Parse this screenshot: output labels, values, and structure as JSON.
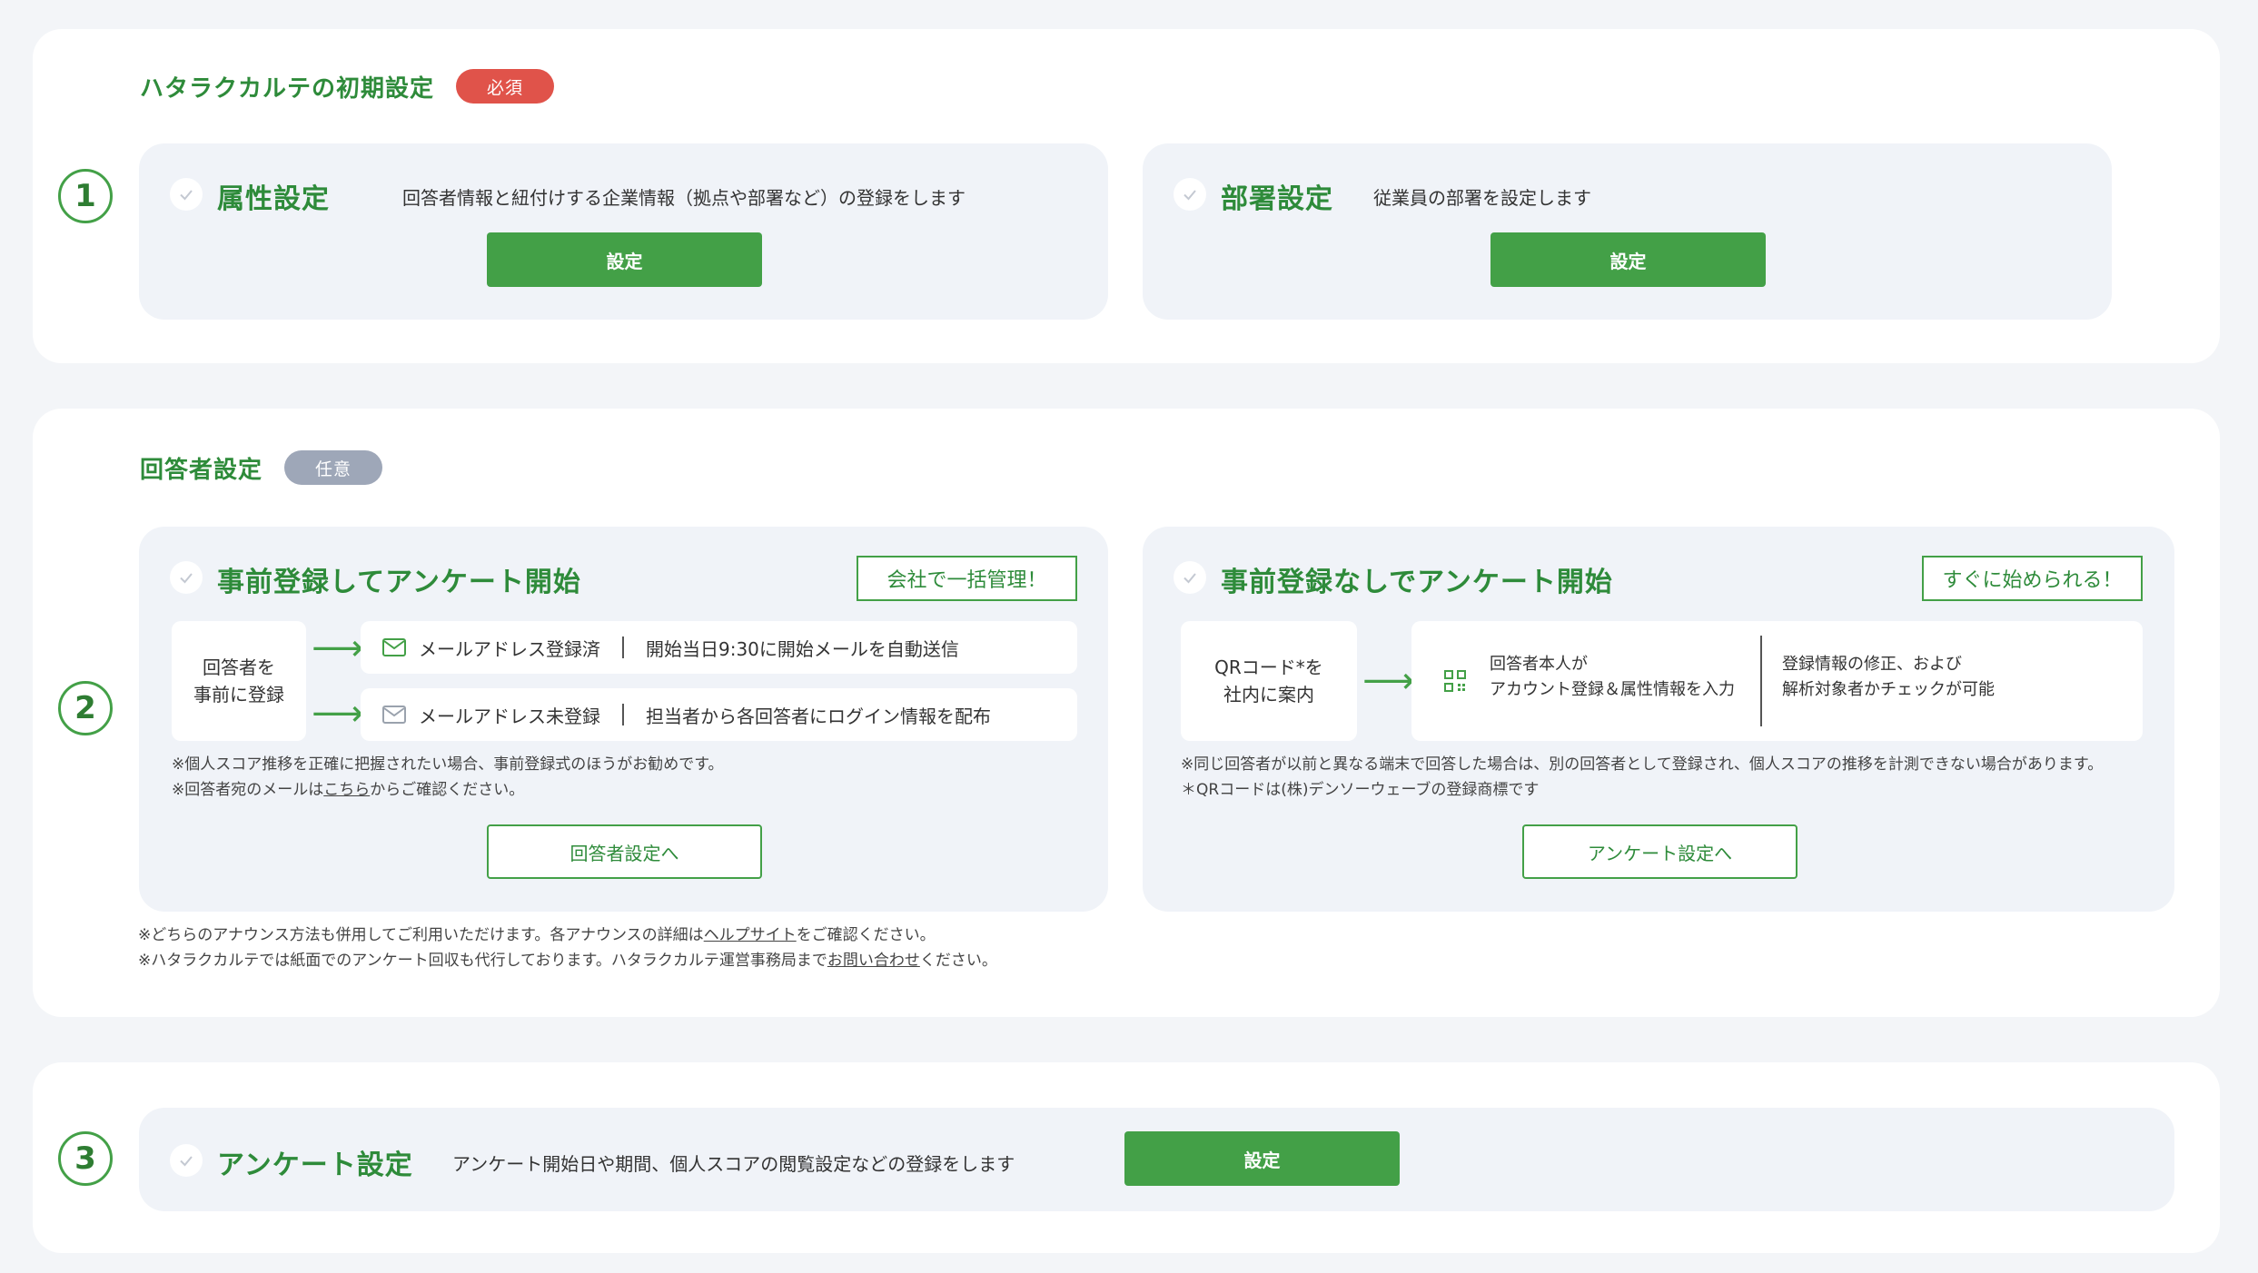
{
  "section1": {
    "number": "1",
    "title": "ハタラクカルテの初期設定",
    "badge": "必須",
    "cards": [
      {
        "title": "属性設定",
        "desc": "回答者情報と紐付けする企業情報（拠点や部署など）の登録をします",
        "button": "設定"
      },
      {
        "title": "部署設定",
        "desc": "従業員の部署を設定します",
        "button": "設定"
      }
    ]
  },
  "section2": {
    "number": "2",
    "title": "回答者設定",
    "badge": "任意",
    "left": {
      "title": "事前登録してアンケート開始",
      "tag": "会社で一括管理！",
      "start_box": [
        "回答者を",
        "事前に登録"
      ],
      "row1_label": "メールアドレス登録済",
      "row1_detail": "開始当日9:30に開始メールを自動送信",
      "row2_label": "メールアドレス未登録",
      "row2_detail": "担当者から各回答者にログイン情報を配布",
      "note1": "※個人スコア推移を正確に把握されたい場合、事前登録式のほうがお勧めです。",
      "note2_pre": "※回答者宛のメールは",
      "note2_link": "こちら",
      "note2_post": "からご確認ください。",
      "button": "回答者設定へ"
    },
    "right": {
      "title": "事前登録なしでアンケート開始",
      "tag": "すぐに始められる！",
      "start_box": [
        "QRコード*を",
        "社内に案内"
      ],
      "flow1": [
        "回答者本人が",
        "アカウント登録＆属性情報を入力"
      ],
      "flow2": [
        "登録情報の修正、および",
        "解析対象者かチェックが可能"
      ],
      "note1": "※同じ回答者が以前と異なる端末で回答した場合は、別の回答者として登録され、個人スコアの推移を計測できない場合があります。",
      "note2": "＊QRコードは(株)デンソーウェーブの登録商標です",
      "button": "アンケート設定へ"
    },
    "footer1_pre": "※どちらのアナウンス方法も併用してご利用いただけます。各アナウンスの詳細は",
    "footer1_link": "ヘルプサイト",
    "footer1_post": "をご確認ください。",
    "footer2_pre": "※ハタラクカルテでは紙面でのアンケート回収も代行しております。ハタラクカルテ運営事務局まで",
    "footer2_link": "お問い合わせ",
    "footer2_post": "ください。"
  },
  "section3": {
    "number": "3",
    "card": {
      "title": "アンケート設定",
      "desc": "アンケート開始日や期間、個人スコアの閲覧設定などの登録をします",
      "button": "設定"
    }
  },
  "colors": {
    "brand_green": "#43a047",
    "required_red": "#e0534a",
    "optional_gray": "#9ea7b8"
  },
  "icons": [
    "check-icon",
    "mail-icon",
    "arrow-right-icon",
    "qr-icon"
  ]
}
